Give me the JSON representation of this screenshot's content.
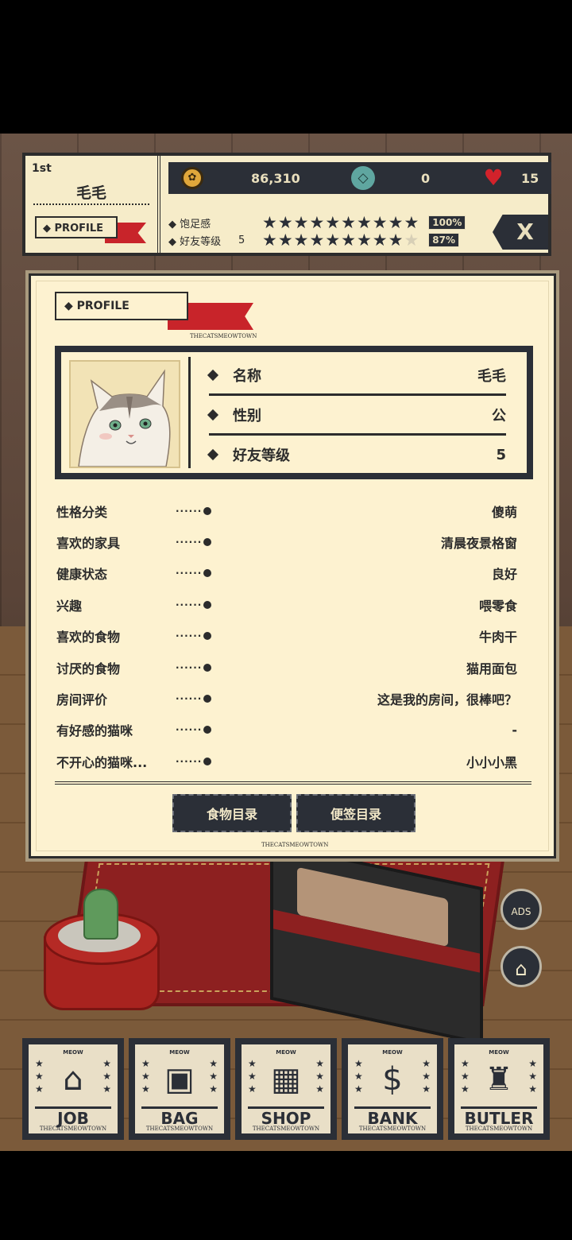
{
  "hud": {
    "rank": "1st",
    "name": "毛毛",
    "profile_button": "PROFILE",
    "coins": "86,310",
    "gems": "0",
    "hearts": "15",
    "satiety_label": "饱足感",
    "satiety_percent": "100%",
    "satiety_stars": 10,
    "friend_label": "好友等级",
    "friend_level": "5",
    "friend_percent": "87%",
    "friend_stars": 8.7,
    "close_label": "X"
  },
  "panel": {
    "title": "PROFILE",
    "brand": "THECATSMEOWTOWN",
    "fields": [
      {
        "label": "名称",
        "value": "毛毛"
      },
      {
        "label": "性别",
        "value": "公"
      },
      {
        "label": "好友等级",
        "value": "5"
      }
    ],
    "details": [
      {
        "label": "性格分类",
        "value": "傻萌"
      },
      {
        "label": "喜欢的家具",
        "value": "清晨夜景格窗"
      },
      {
        "label": "健康状态",
        "value": "良好"
      },
      {
        "label": "兴趣",
        "value": "喂零食"
      },
      {
        "label": "喜欢的食物",
        "value": "牛肉干"
      },
      {
        "label": "讨厌的食物",
        "value": "猫用面包"
      },
      {
        "label": "房间评价",
        "value": "这是我的房间，很棒吧？"
      },
      {
        "label": "有好感的猫咪",
        "value": "-"
      },
      {
        "label": "不开心的猫咪...",
        "value": "小小小黑"
      }
    ],
    "food_button": "食物目录",
    "note_button": "便签目录"
  },
  "side": {
    "ads_label": "ADS"
  },
  "nav": [
    {
      "label": "JOB",
      "icon": "house-icon"
    },
    {
      "label": "BAG",
      "icon": "bag-icon"
    },
    {
      "label": "SHOP",
      "icon": "basket-icon"
    },
    {
      "label": "BANK",
      "icon": "dollar-icon"
    },
    {
      "label": "BUTLER",
      "icon": "tophat-icon"
    }
  ],
  "nav_meow": "MEOW",
  "nav_brand": "THECATSMEOWTOWN",
  "colors": {
    "dark": "#2b2f37",
    "paper": "#fdf2d0",
    "red": "#c8242a"
  }
}
